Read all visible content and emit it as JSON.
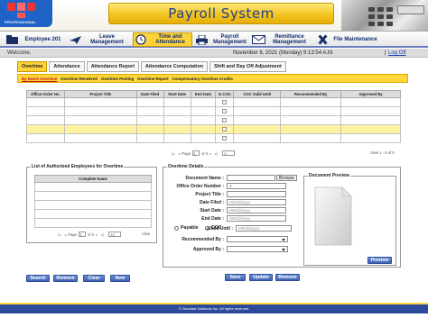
{
  "header": {
    "logo_text": "PROFESSIONAL",
    "title": "Payroll System"
  },
  "nav": {
    "items": [
      {
        "label": "Employee 201",
        "icon": "folder-icon"
      },
      {
        "label": "Leave Management",
        "icon": "plane-icon"
      },
      {
        "label": "Time and Attendance",
        "icon": "clock-icon",
        "active": true
      },
      {
        "label": "Payroll Management",
        "icon": "printer-icon"
      },
      {
        "label": "Remittance Management",
        "icon": "envelope-icon"
      },
      {
        "label": "File Maintenance",
        "icon": "tools-icon"
      }
    ]
  },
  "welcome": {
    "greeting": "Welcome,",
    "datetime": "November 8, 2021 (Monday) 9:13:54 A.M.",
    "separator": "|",
    "logout": "Log Off"
  },
  "tabs": [
    "Overtime",
    "Attendance",
    "Attendance Report",
    "Attendance Computation",
    "Shift and Day Off Adjustment"
  ],
  "subtabs": [
    "By Batch Overtime",
    "Overtime Rendered",
    "Overtime Posting",
    "Overtime Report",
    "Compensatory Overtime Credits"
  ],
  "overtime_grid": {
    "columns": [
      "Office Order No.",
      "Project Title",
      "Date Filed",
      "Start Date",
      "End Date",
      "Is COC",
      "COC Valid Until",
      "Recommended By",
      "Approved By"
    ],
    "pager": {
      "page_label": "Page",
      "page_value": "1",
      "of_label": "of 0",
      "page_size": "5",
      "view_label": "View 1 - 5 of 5"
    }
  },
  "employees_panel": {
    "legend": "List of Authorized Employees for Overtime",
    "column": "Complete Name",
    "pager": {
      "page_label": "Page",
      "page_value": "1",
      "of_label": "of 0",
      "page_size": "10",
      "view_label": "View"
    }
  },
  "details": {
    "legend": "Overtime Details",
    "document_name_label": "Document Name :",
    "browse_label": "Browse",
    "office_order_label": "Office Order Number :",
    "office_order_value": "1",
    "project_title_label": "Project Title :",
    "date_filed_label": "Date Filed :",
    "date_filed_placeholder": "MM/dd/yyyy",
    "start_date_label": "Start Date :",
    "start_date_placeholder": "MM/dd/yyyy",
    "end_date_label": "End Date :",
    "end_date_placeholder": "MM/dd/yyyy",
    "payable_label": "Payable",
    "coc_label": "COC",
    "selected_option": "COC",
    "valid_until_label": "Valid Until :",
    "valid_until_placeholder": "MM/dd/yyyy",
    "recommended_by_label": "Recommended By :",
    "approved_by_label": "Approved By :"
  },
  "preview": {
    "legend": "Document Preview",
    "button": "Preview"
  },
  "buttons": {
    "search": "Search",
    "remove": "Remove",
    "clear": "Clear",
    "new": "New",
    "save": "Save",
    "update": "Update",
    "remove2": "Remove"
  },
  "footer": {
    "text": "© Geodata Solutions Inc. All rights reserved."
  },
  "colors": {
    "accent_yellow": "#fdd23a",
    "nav_blue": "#1f3f8a",
    "button_blue": "#3f62b4",
    "footer_blue": "#2c4a9a"
  }
}
